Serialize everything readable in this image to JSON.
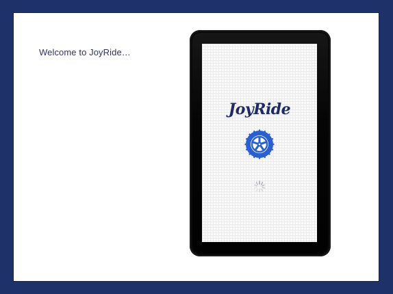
{
  "welcome": {
    "text": "Welcome to JoyRide…"
  },
  "device": {
    "logo_text": "JoyRide",
    "wheel_icon": "tire-wheel-icon",
    "spinner_icon": "loading-spinner-icon"
  },
  "colors": {
    "background": "#1f3169",
    "slide": "#ffffff",
    "logo": "#1f2a63",
    "wheel": "#2a5fd0"
  }
}
